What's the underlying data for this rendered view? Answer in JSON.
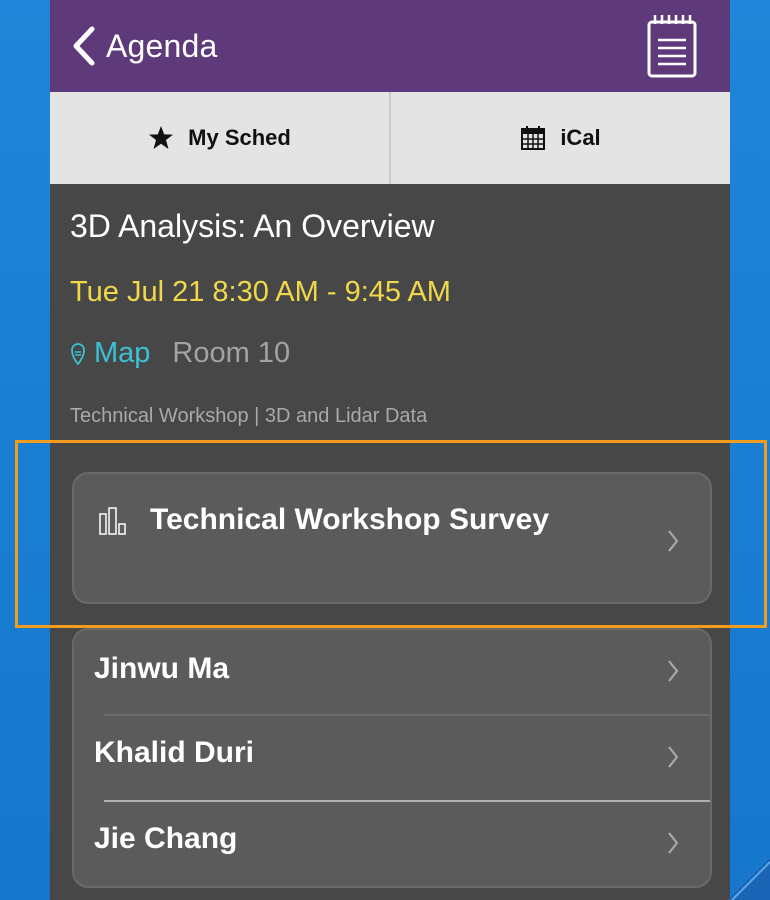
{
  "header": {
    "back_label": "Agenda",
    "back_icon": "chevron-left-icon",
    "notes_icon": "notepad-icon",
    "color": "#5e3a7b"
  },
  "toolbar": {
    "my_sched_label": "My Sched",
    "my_sched_icon": "star-icon",
    "ical_label": "iCal",
    "ical_icon": "calendar-icon"
  },
  "session": {
    "title": "3D Analysis: An Overview",
    "datetime": "Tue Jul 21 8:30 AM - 9:45 AM",
    "map_label": "Map",
    "room": "Room 10",
    "track": "Technical Workshop | 3D and Lidar Data"
  },
  "survey": {
    "label": "Technical Workshop Survey",
    "icon": "bar-chart-icon"
  },
  "speakers": [
    {
      "name": "Jinwu Ma"
    },
    {
      "name": "Khalid Duri"
    },
    {
      "name": "Jie Chang"
    }
  ],
  "colors": {
    "datetime": "#f0d84a",
    "map_link": "#3cc0d4",
    "highlight": "#f39b1c",
    "background": "#474747"
  }
}
